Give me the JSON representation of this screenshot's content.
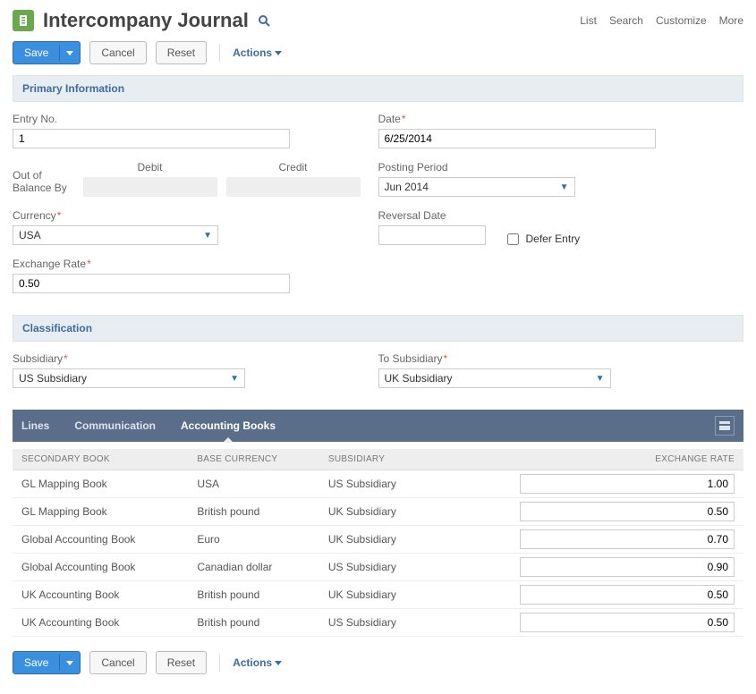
{
  "header": {
    "title": "Intercompany Journal",
    "links": [
      "List",
      "Search",
      "Customize",
      "More"
    ]
  },
  "toolbar": {
    "save": "Save",
    "cancel": "Cancel",
    "reset": "Reset",
    "actions": "Actions"
  },
  "sections": {
    "primary": "Primary Information",
    "classification": "Classification"
  },
  "fields": {
    "entry_no_label": "Entry No.",
    "entry_no_value": "1",
    "out_of_balance_label": "Out of Balance By",
    "debit_label": "Debit",
    "credit_label": "Credit",
    "currency_label": "Currency",
    "currency_value": "USA",
    "exchange_rate_label": "Exchange Rate",
    "exchange_rate_value": "0.50",
    "date_label": "Date",
    "date_value": "6/25/2014",
    "posting_period_label": "Posting Period",
    "posting_period_value": "Jun 2014",
    "reversal_date_label": "Reversal Date",
    "reversal_date_value": "",
    "defer_entry_label": "Defer Entry",
    "subsidiary_label": "Subsidiary",
    "subsidiary_value": "US Subsidiary",
    "to_subsidiary_label": "To Subsidiary",
    "to_subsidiary_value": "UK Subsidiary"
  },
  "tabs": [
    "Lines",
    "Communication",
    "Accounting Books"
  ],
  "active_tab": "Accounting Books",
  "books": {
    "columns": [
      "SECONDARY BOOK",
      "BASE CURRENCY",
      "SUBSIDIARY",
      "EXCHANGE RATE"
    ],
    "rows": [
      {
        "book": "GL Mapping Book",
        "currency": "USA",
        "sub": "US Subsidiary",
        "rate": "1.00"
      },
      {
        "book": "GL Mapping Book",
        "currency": "British pound",
        "sub": "UK Subsidiary",
        "rate": "0.50"
      },
      {
        "book": "Global Accounting Book",
        "currency": "Euro",
        "sub": "UK Subsidiary",
        "rate": "0.70"
      },
      {
        "book": "Global Accounting Book",
        "currency": "Canadian dollar",
        "sub": "US Subsidiary",
        "rate": "0.90"
      },
      {
        "book": "UK Accounting Book",
        "currency": "British pound",
        "sub": "UK Subsidiary",
        "rate": "0.50"
      },
      {
        "book": "UK Accounting Book",
        "currency": "British pound",
        "sub": "US Subsidiary",
        "rate": "0.50"
      }
    ]
  }
}
